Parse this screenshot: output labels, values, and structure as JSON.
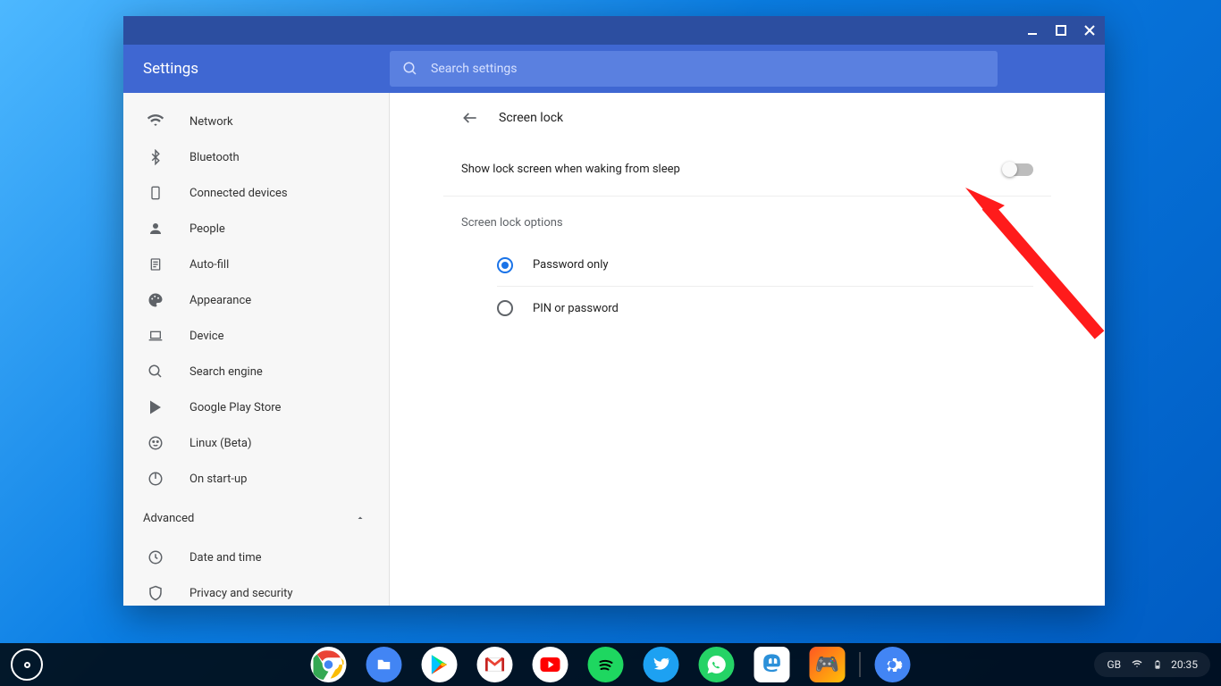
{
  "window": {
    "title": "Settings",
    "search_placeholder": "Search settings"
  },
  "sidebar": {
    "items": [
      {
        "label": "Network",
        "icon": "wifi"
      },
      {
        "label": "Bluetooth",
        "icon": "bluetooth"
      },
      {
        "label": "Connected devices",
        "icon": "phone"
      },
      {
        "label": "People",
        "icon": "person"
      },
      {
        "label": "Auto-fill",
        "icon": "clipboard"
      },
      {
        "label": "Appearance",
        "icon": "palette"
      },
      {
        "label": "Device",
        "icon": "laptop"
      },
      {
        "label": "Search engine",
        "icon": "search"
      },
      {
        "label": "Google Play Store",
        "icon": "play"
      },
      {
        "label": "Linux (Beta)",
        "icon": "linux"
      },
      {
        "label": "On start-up",
        "icon": "power"
      }
    ],
    "advanced_label": "Advanced",
    "advanced_items": [
      {
        "label": "Date and time",
        "icon": "clock"
      },
      {
        "label": "Privacy and security",
        "icon": "shield"
      }
    ]
  },
  "page": {
    "title": "Screen lock",
    "toggle_label": "Show lock screen when waking from sleep",
    "toggle_value": false,
    "options_heading": "Screen lock options",
    "options": [
      {
        "label": "Password only",
        "checked": true
      },
      {
        "label": "PIN or password",
        "checked": false
      }
    ]
  },
  "shelf": {
    "apps": [
      "chrome",
      "files",
      "play",
      "gmail",
      "youtube",
      "spotify",
      "twitter",
      "whatsapp",
      "mastodon",
      "game"
    ],
    "pinned_app": "settings"
  },
  "tray": {
    "locale": "GB",
    "time": "20:35"
  },
  "annotation": {
    "color": "#ff1b1b"
  }
}
